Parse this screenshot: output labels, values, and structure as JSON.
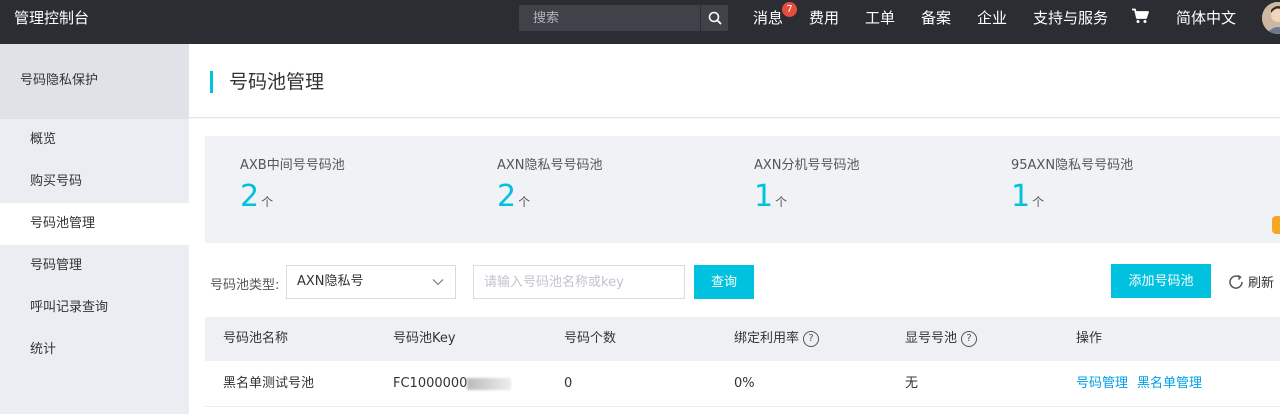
{
  "topbar": {
    "brand": "管理控制台",
    "search_placeholder": "搜索",
    "nav": {
      "messages": "消息",
      "messages_count": "7",
      "billing": "费用",
      "tickets": "工单",
      "icp": "备案",
      "enterprise": "企业",
      "support": "支持与服务",
      "language": "简体中文"
    }
  },
  "sidebar": {
    "header": "号码隐私保护",
    "items": [
      {
        "label": "概览"
      },
      {
        "label": "购买号码"
      },
      {
        "label": "号码池管理"
      },
      {
        "label": "号码管理"
      },
      {
        "label": "呼叫记录查询"
      },
      {
        "label": "统计"
      }
    ]
  },
  "page": {
    "title": "号码池管理"
  },
  "stats": [
    {
      "label": "AXB中间号号码池",
      "value": "2",
      "unit": "个"
    },
    {
      "label": "AXN隐私号号码池",
      "value": "2",
      "unit": "个"
    },
    {
      "label": "AXN分机号号码池",
      "value": "1",
      "unit": "个"
    },
    {
      "label": "95AXN隐私号号码池",
      "value": "1",
      "unit": "个"
    }
  ],
  "filter": {
    "type_label": "号码池类型:",
    "type_value": "AXN隐私号",
    "key_placeholder": "请输入号码池名称或key",
    "query_button": "查询",
    "add_button": "添加号码池",
    "refresh_label": "刷新"
  },
  "table": {
    "headers": [
      "号码池名称",
      "号码池Key",
      "号码个数",
      "绑定利用率",
      "显号号池",
      "操作"
    ],
    "rows": [
      {
        "name": "黑名单测试号池",
        "key": "FC1000000",
        "count": "0",
        "usage": "0%",
        "display_pool": "无",
        "actions": [
          "号码管理",
          "黑名单管理"
        ]
      }
    ]
  },
  "colors": {
    "accent": "#00c1de",
    "topbar": "#2b2d33",
    "link": "#00a0e9",
    "badge": "#e74c3c"
  }
}
